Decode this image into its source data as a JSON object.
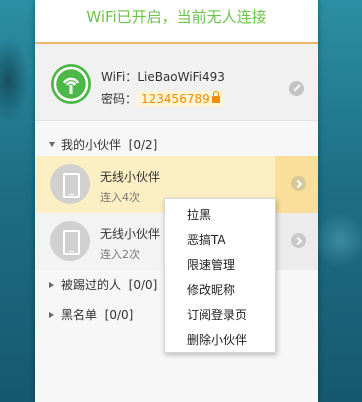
{
  "header": {
    "status": "WiFi已开启，当前无人连接"
  },
  "wifi": {
    "ssid_label": "WiFi：",
    "ssid": "LieBaoWiFi493",
    "password_label": "密码：",
    "password": "123456789",
    "icons": {
      "wifi": "wifi-icon",
      "lock": "lock-icon",
      "edit": "edit-icon"
    }
  },
  "sections": {
    "friends": {
      "label": "我的小伙伴",
      "count": "[0/2]"
    },
    "kicked": {
      "label": "被踢过的人",
      "count": "[0/0]"
    },
    "blacklist": {
      "label": "黑名单",
      "count": "[0/0]"
    }
  },
  "friends": [
    {
      "name": "无线小伙伴",
      "sub": "连入4次"
    },
    {
      "name": "无线小伙伴",
      "sub": "连入2次"
    }
  ],
  "context_menu": {
    "items": [
      "拉黑",
      "恶搞TA",
      "限速管理",
      "修改昵称",
      "订阅登录页",
      "删除小伙伴"
    ]
  },
  "colors": {
    "accent_green": "#6cc34c",
    "password_orange": "#f08c00",
    "highlight": "#fcefc4"
  }
}
